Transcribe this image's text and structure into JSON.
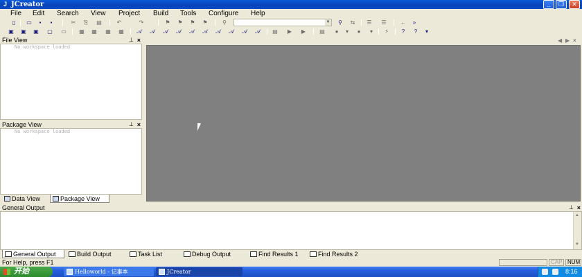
{
  "window": {
    "title": "JCreator",
    "icon": "jcreator-icon",
    "controls": [
      "minimize-icon",
      "restore-icon",
      "close-icon"
    ]
  },
  "menu": {
    "items": [
      "File",
      "Edit",
      "Search",
      "View",
      "Project",
      "Build",
      "Tools",
      "Configure",
      "Help"
    ]
  },
  "file_view": {
    "title": "File View",
    "empty_text": "No workspace loaded"
  },
  "package_view": {
    "title": "Package View",
    "empty_text": "No workspace loaded"
  },
  "left_tabs": {
    "data_view": "Data View",
    "package_view": "Package View"
  },
  "output": {
    "title": "General Output"
  },
  "output_tabs": {
    "general": "General Output",
    "build": "Build Output",
    "tasks": "Task List",
    "debug": "Debug Output",
    "find1": "Find Results 1",
    "find2": "Find Results 2"
  },
  "status": {
    "message": "For Help, press F1",
    "cap": "CAP",
    "num": "NUM"
  },
  "taskbar": {
    "start_label": "开始",
    "tasks": [
      {
        "label": "Helloworld - 记事本",
        "active": false
      },
      {
        "label": "JCreator",
        "active": true
      }
    ],
    "clock": "8:16"
  },
  "colors": {
    "titlebar": "#0a4fc9",
    "editor_bg": "#808080",
    "taskbar": "#245ddb",
    "start": "#2d8a2d"
  }
}
